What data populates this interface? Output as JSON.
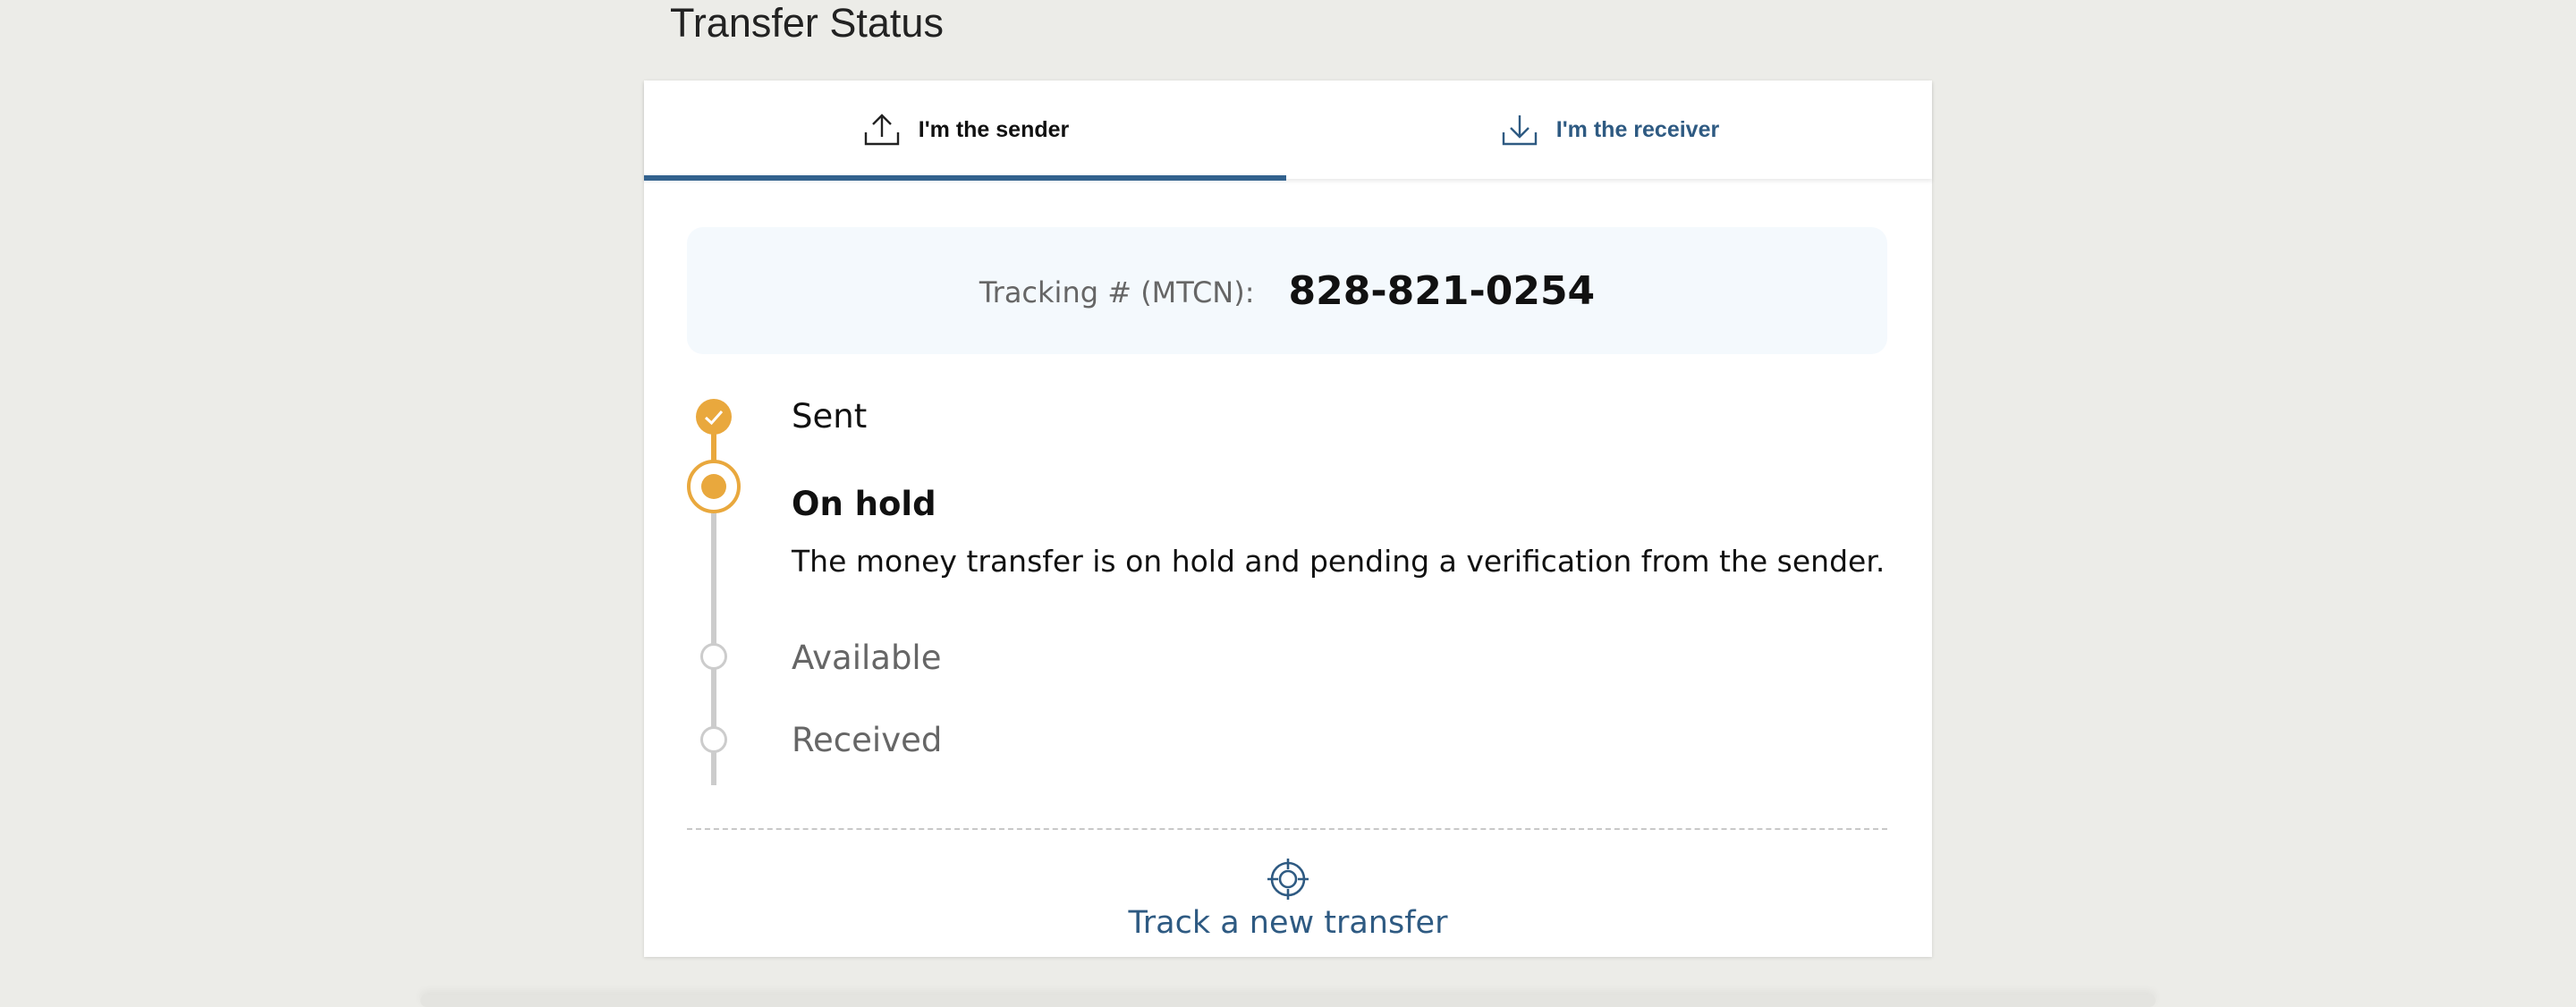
{
  "page": {
    "title": "Transfer Status"
  },
  "tabs": [
    {
      "label": "I'm the sender",
      "icon": "upload-icon",
      "active": true
    },
    {
      "label": "I'm the receiver",
      "icon": "download-icon",
      "active": false
    }
  ],
  "tracking": {
    "label": "Tracking # (MTCN):",
    "value": "828-821-0254"
  },
  "timeline": {
    "steps": [
      {
        "label": "Sent",
        "state": "completed",
        "icon": "check-icon"
      },
      {
        "label": "On hold",
        "state": "current",
        "description": "The money transfer is on hold and pending a verification from the sender."
      },
      {
        "label": "Available",
        "state": "pending"
      },
      {
        "label": "Received",
        "state": "pending"
      }
    ]
  },
  "actions": {
    "track_new_label": "Track a new transfer",
    "track_new_icon": "crosshair-icon"
  },
  "colors": {
    "accent": "#e9a83d",
    "link": "#2e5a82",
    "tab_indicator": "#33628e",
    "pending": "#cccccc",
    "tracking_bg": "#f4f9fd"
  }
}
